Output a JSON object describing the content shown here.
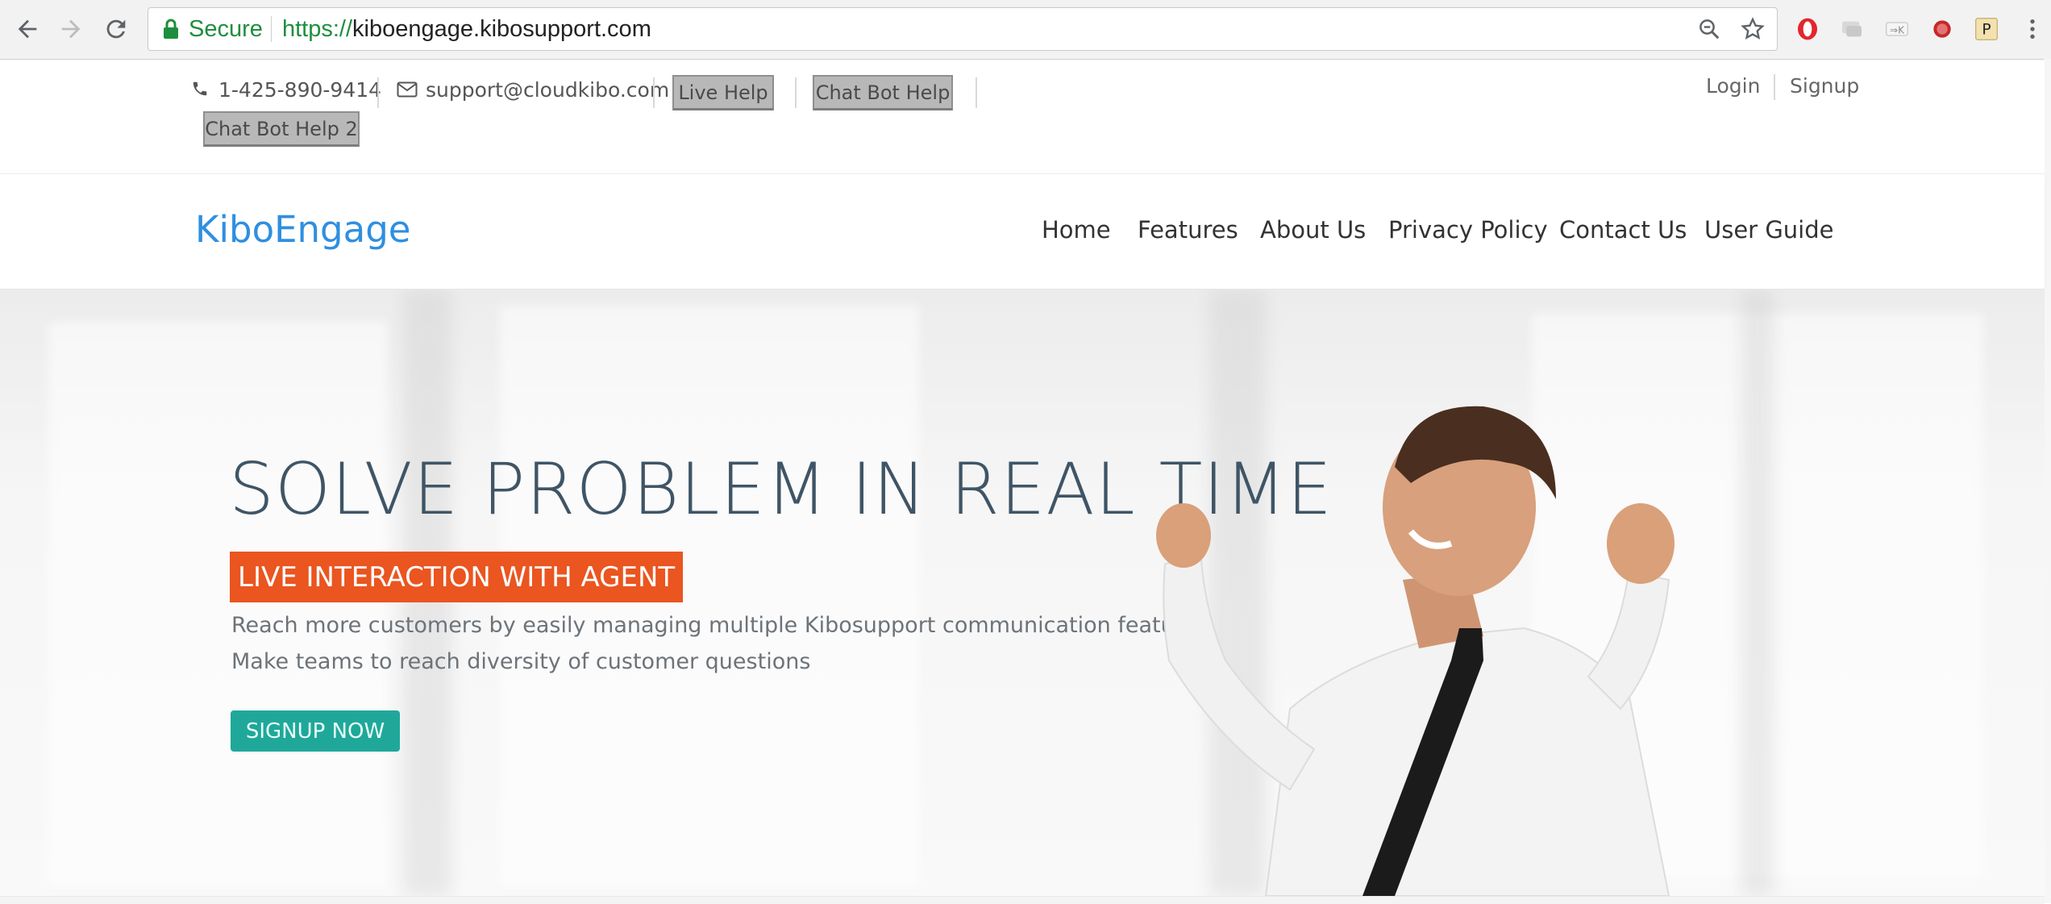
{
  "browser": {
    "secure_label": "Secure",
    "url_scheme": "https://",
    "url_host": "kiboengage.kibosupport.com"
  },
  "topbar": {
    "phone": "1-425-890-9414",
    "email": "support@cloudkibo.com",
    "live_help": "Live Help",
    "chat_bot_help": "Chat Bot Help",
    "chat_bot_help_2": "Chat Bot Help 2",
    "login": "Login",
    "signup": "Signup"
  },
  "navbar": {
    "brand": "KiboEngage",
    "items": [
      "Home",
      "Features",
      "About Us",
      "Privacy Policy",
      "Contact Us",
      "User Guide"
    ]
  },
  "hero": {
    "title": "SOLVE PROBLEM IN REAL TIME",
    "tag": "LIVE INTERACTION WITH AGENT",
    "line1": "Reach more customers by easily managing multiple Kibosupport communication features",
    "line2": "Make teams to reach diversity of customer questions",
    "cta": "SIGNUP NOW"
  },
  "colors": {
    "brand": "#2f8fe0",
    "tag_bg": "#ea5520",
    "cta_bg": "#1fa89a",
    "secure": "#1e8e3e"
  },
  "icons": [
    "back-arrow-icon",
    "forward-arrow-icon",
    "reload-icon",
    "lock-icon",
    "zoom-icon",
    "star-icon",
    "phone-icon",
    "envelope-icon"
  ]
}
